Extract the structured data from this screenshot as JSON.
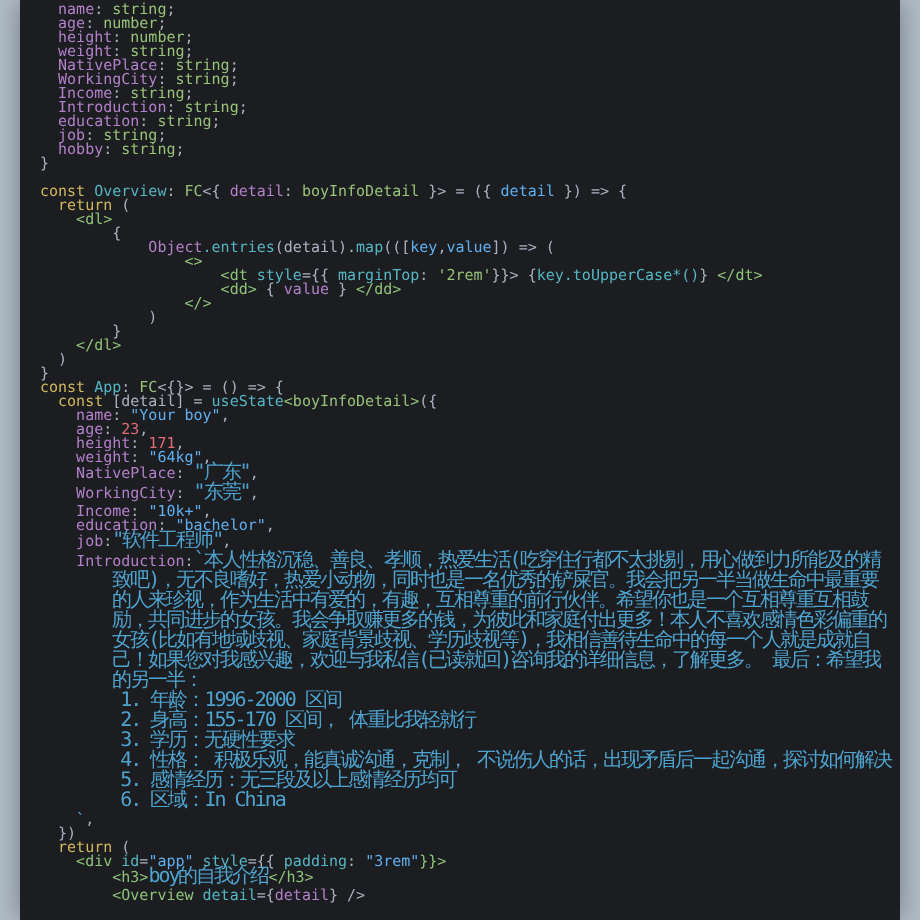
{
  "editor": {
    "lines": [
      {
        "kind": "code",
        "tokens": [
          {
            "t": "  name",
            "kind": "key"
          },
          {
            "t": ": ",
            "kind": "plain"
          },
          {
            "t": "string",
            "kind": "type"
          },
          {
            "t": ";",
            "kind": "plain"
          }
        ]
      },
      {
        "kind": "code",
        "tokens": [
          {
            "t": "  age",
            "kind": "key"
          },
          {
            "t": ": ",
            "kind": "plain"
          },
          {
            "t": "number",
            "kind": "type"
          },
          {
            "t": ";",
            "kind": "plain"
          }
        ]
      },
      {
        "kind": "code",
        "tokens": [
          {
            "t": "  height",
            "kind": "key"
          },
          {
            "t": ": ",
            "kind": "plain"
          },
          {
            "t": "number",
            "kind": "type"
          },
          {
            "t": ";",
            "kind": "plain"
          }
        ]
      },
      {
        "kind": "code",
        "tokens": [
          {
            "t": "  weight",
            "kind": "key"
          },
          {
            "t": ": ",
            "kind": "plain"
          },
          {
            "t": "string",
            "kind": "type"
          },
          {
            "t": ";",
            "kind": "plain"
          }
        ]
      },
      {
        "kind": "code",
        "tokens": [
          {
            "t": "  NativePlace",
            "kind": "key"
          },
          {
            "t": ": ",
            "kind": "plain"
          },
          {
            "t": "string",
            "kind": "type"
          },
          {
            "t": ";",
            "kind": "plain"
          }
        ]
      },
      {
        "kind": "code",
        "tokens": [
          {
            "t": "  WorkingCity",
            "kind": "key"
          },
          {
            "t": ": ",
            "kind": "plain"
          },
          {
            "t": "string",
            "kind": "type"
          },
          {
            "t": ";",
            "kind": "plain"
          }
        ]
      },
      {
        "kind": "code",
        "tokens": [
          {
            "t": "  Income",
            "kind": "key"
          },
          {
            "t": ": ",
            "kind": "plain"
          },
          {
            "t": "string",
            "kind": "type"
          },
          {
            "t": ";",
            "kind": "plain"
          }
        ]
      },
      {
        "kind": "code",
        "tokens": [
          {
            "t": "  Introduction",
            "kind": "key"
          },
          {
            "t": ": ",
            "kind": "plain"
          },
          {
            "t": "string",
            "kind": "type"
          },
          {
            "t": ";",
            "kind": "plain"
          }
        ]
      },
      {
        "kind": "code",
        "tokens": [
          {
            "t": "  education",
            "kind": "key"
          },
          {
            "t": ": ",
            "kind": "plain"
          },
          {
            "t": "string",
            "kind": "type"
          },
          {
            "t": ";",
            "kind": "plain"
          }
        ]
      },
      {
        "kind": "code",
        "tokens": [
          {
            "t": "  job",
            "kind": "key"
          },
          {
            "t": ": ",
            "kind": "plain"
          },
          {
            "t": "string",
            "kind": "type"
          },
          {
            "t": ";",
            "kind": "plain"
          }
        ]
      },
      {
        "kind": "code",
        "tokens": [
          {
            "t": "  hobby",
            "kind": "key"
          },
          {
            "t": ": ",
            "kind": "plain"
          },
          {
            "t": "string",
            "kind": "type"
          },
          {
            "t": ";",
            "kind": "plain"
          }
        ]
      },
      {
        "kind": "code",
        "tokens": [
          {
            "t": "}",
            "kind": "plain"
          }
        ]
      },
      {
        "kind": "blank"
      },
      {
        "kind": "code",
        "tokens": [
          {
            "t": "const ",
            "kind": "keyword"
          },
          {
            "t": "Overview",
            "kind": "fn"
          },
          {
            "t": ": ",
            "kind": "plain"
          },
          {
            "t": "FC",
            "kind": "type"
          },
          {
            "t": "<{ ",
            "kind": "plain"
          },
          {
            "t": "detail",
            "kind": "key"
          },
          {
            "t": ": ",
            "kind": "plain"
          },
          {
            "t": "boyInfoDetail",
            "kind": "type"
          },
          {
            "t": " }> = ({ ",
            "kind": "plain"
          },
          {
            "t": "detail",
            "kind": "var"
          },
          {
            "t": " }) => {",
            "kind": "plain"
          }
        ]
      },
      {
        "kind": "code",
        "tokens": [
          {
            "t": "  return",
            "kind": "keyword"
          },
          {
            "t": " (",
            "kind": "plain"
          }
        ]
      },
      {
        "kind": "code",
        "tokens": [
          {
            "t": "    <dl>",
            "kind": "tag"
          }
        ]
      },
      {
        "kind": "code",
        "tokens": [
          {
            "t": "        {",
            "kind": "plain"
          }
        ]
      },
      {
        "kind": "code",
        "tokens": [
          {
            "t": "            Object",
            "kind": "key"
          },
          {
            "t": ".entries",
            "kind": "fn"
          },
          {
            "t": "(detail).",
            "kind": "plain"
          },
          {
            "t": "map",
            "kind": "fn"
          },
          {
            "t": "(([",
            "kind": "plain"
          },
          {
            "t": "key",
            "kind": "var"
          },
          {
            "t": ",",
            "kind": "plain"
          },
          {
            "t": "value",
            "kind": "var"
          },
          {
            "t": "]) => (",
            "kind": "plain"
          }
        ]
      },
      {
        "kind": "code",
        "tokens": [
          {
            "t": "                <>",
            "kind": "tag"
          }
        ]
      },
      {
        "kind": "code",
        "tokens": [
          {
            "t": "                    <dt ",
            "kind": "tag"
          },
          {
            "t": "style",
            "kind": "fn"
          },
          {
            "t": "={{ ",
            "kind": "plain"
          },
          {
            "t": "marginTop",
            "kind": "fn"
          },
          {
            "t": ": ",
            "kind": "plain"
          },
          {
            "t": "'2rem'",
            "kind": "type"
          },
          {
            "t": "}}> {",
            "kind": "plain"
          },
          {
            "t": "key.toUpperCase*()",
            "kind": "fn"
          },
          {
            "t": "} ",
            "kind": "plain"
          },
          {
            "t": "</dt>",
            "kind": "tag"
          }
        ]
      },
      {
        "kind": "code",
        "tokens": [
          {
            "t": "                    <dd>",
            "kind": "tag"
          },
          {
            "t": " { ",
            "kind": "plain"
          },
          {
            "t": "value",
            "kind": "key"
          },
          {
            "t": " } ",
            "kind": "plain"
          },
          {
            "t": "</dd>",
            "kind": "tag"
          }
        ]
      },
      {
        "kind": "code",
        "tokens": [
          {
            "t": "                </>",
            "kind": "tag"
          }
        ]
      },
      {
        "kind": "code",
        "tokens": [
          {
            "t": "            )",
            "kind": "plain"
          }
        ]
      },
      {
        "kind": "code",
        "tokens": [
          {
            "t": "        }",
            "kind": "plain"
          }
        ]
      },
      {
        "kind": "code",
        "tokens": [
          {
            "t": "    </dl>",
            "kind": "tag"
          }
        ]
      },
      {
        "kind": "code",
        "tokens": [
          {
            "t": "  )",
            "kind": "plain"
          }
        ]
      },
      {
        "kind": "code",
        "tokens": [
          {
            "t": "}",
            "kind": "plain"
          }
        ]
      },
      {
        "kind": "code",
        "tokens": [
          {
            "t": "const ",
            "kind": "keyword"
          },
          {
            "t": "App",
            "kind": "fn"
          },
          {
            "t": ": ",
            "kind": "plain"
          },
          {
            "t": "FC",
            "kind": "type"
          },
          {
            "t": "<{}> = () => {",
            "kind": "plain"
          }
        ]
      },
      {
        "kind": "code",
        "tokens": [
          {
            "t": "  const ",
            "kind": "keyword"
          },
          {
            "t": "[detail] = ",
            "kind": "plain"
          },
          {
            "t": "useState",
            "kind": "fn"
          },
          {
            "t": "<boyInfoDetail>",
            "kind": "type"
          },
          {
            "t": "({",
            "kind": "plain"
          }
        ]
      },
      {
        "kind": "code",
        "tokens": [
          {
            "t": "    name",
            "kind": "key"
          },
          {
            "t": ": ",
            "kind": "plain"
          },
          {
            "t": "\"Your boy\"",
            "kind": "string"
          },
          {
            "t": ",",
            "kind": "plain"
          }
        ]
      },
      {
        "kind": "code",
        "tokens": [
          {
            "t": "    age",
            "kind": "key"
          },
          {
            "t": ": ",
            "kind": "plain"
          },
          {
            "t": "23",
            "kind": "number"
          },
          {
            "t": ",",
            "kind": "plain"
          }
        ]
      },
      {
        "kind": "code",
        "tokens": [
          {
            "t": "    height",
            "kind": "key"
          },
          {
            "t": ": ",
            "kind": "plain"
          },
          {
            "t": "171",
            "kind": "number"
          },
          {
            "t": ",",
            "kind": "plain"
          }
        ]
      },
      {
        "kind": "code",
        "tokens": [
          {
            "t": "    weight",
            "kind": "key"
          },
          {
            "t": ": ",
            "kind": "plain"
          },
          {
            "t": "\"64kg\"",
            "kind": "string"
          },
          {
            "t": ",",
            "kind": "plain"
          }
        ]
      },
      {
        "kind": "code",
        "tokens": [
          {
            "t": "    NativePlace",
            "kind": "key"
          },
          {
            "t": ": ",
            "kind": "plain"
          },
          {
            "t": "\"广东\"",
            "kind": "zh"
          },
          {
            "t": ",",
            "kind": "plain"
          }
        ]
      },
      {
        "kind": "code",
        "tokens": [
          {
            "t": "    WorkingCity",
            "kind": "key"
          },
          {
            "t": ": ",
            "kind": "plain"
          },
          {
            "t": "\"东莞\"",
            "kind": "zh"
          },
          {
            "t": ",",
            "kind": "plain"
          }
        ]
      },
      {
        "kind": "code",
        "tokens": [
          {
            "t": "    Income",
            "kind": "key"
          },
          {
            "t": ": ",
            "kind": "plain"
          },
          {
            "t": "\"10k+\"",
            "kind": "string"
          },
          {
            "t": ",",
            "kind": "plain"
          }
        ]
      },
      {
        "kind": "code",
        "tokens": [
          {
            "t": "    education",
            "kind": "key"
          },
          {
            "t": ": ",
            "kind": "plain"
          },
          {
            "t": "\"bachelor\"",
            "kind": "string"
          },
          {
            "t": ",",
            "kind": "plain"
          }
        ]
      },
      {
        "kind": "code",
        "tokens": [
          {
            "t": "    job",
            "kind": "key"
          },
          {
            "t": ":",
            "kind": "plain"
          },
          {
            "t": "\"软件工程师\"",
            "kind": "zh"
          },
          {
            "t": ",",
            "kind": "plain"
          }
        ]
      },
      {
        "kind": "wrapped",
        "tokens": [
          {
            "t": "    Introduction",
            "kind": "key"
          },
          {
            "t": ":",
            "kind": "plain"
          },
          {
            "t": "`本人性格沉稳、善良、孝顺，热爱生活(吃穿住行都不太挑剔，用心做到力所能及的精致吧)，无不良嗜好，热爱小动物，同时也是一名优秀的铲屎官。我会把另一半当做生命中最重要的人来珍视，作为生活中有爱的，有趣，互相尊重的前行伙伴。希望你也是一个互相尊重互相鼓励，共同进步的女孩。我会争取赚更多的钱，为彼此和家庭付出更多！本人不喜欢感情色彩偏重的女孩(比如有地域歧视、家庭背景歧视、学历歧视等)，我相信善待生命中的每一个人就是成就自己！如果您对我感兴趣，欢迎与我私信(已读就回)咨询我的详细信息，了解更多。 最后：希望我的另一半：",
            "kind": "zh"
          }
        ]
      },
      {
        "kind": "code",
        "tokens": [
          {
            "t": "        1. 年龄：1996-2000 区间",
            "kind": "zh"
          }
        ]
      },
      {
        "kind": "code",
        "tokens": [
          {
            "t": "        2. 身高：155-170 区间， 体重比我轻就行",
            "kind": "zh"
          }
        ]
      },
      {
        "kind": "code",
        "tokens": [
          {
            "t": "        3. 学历：无硬性要求",
            "kind": "zh"
          }
        ]
      },
      {
        "kind": "code",
        "tokens": [
          {
            "t": "        4. 性格： 积极乐观，能真诚沟通，克制， 不说伤人的话，出现矛盾后一起沟通，探讨如何解决",
            "kind": "zh"
          }
        ]
      },
      {
        "kind": "code",
        "tokens": [
          {
            "t": "        5. 感情经历：无三段及以上感情经历均可",
            "kind": "zh"
          }
        ]
      },
      {
        "kind": "code",
        "tokens": [
          {
            "t": "        6. 区域：In China",
            "kind": "zh"
          }
        ]
      },
      {
        "kind": "code",
        "tokens": [
          {
            "t": "    `",
            "kind": "string"
          },
          {
            "t": ",",
            "kind": "plain"
          }
        ]
      },
      {
        "kind": "code",
        "tokens": [
          {
            "t": "  })",
            "kind": "plain"
          }
        ]
      },
      {
        "kind": "code",
        "tokens": [
          {
            "t": "  return",
            "kind": "keyword"
          },
          {
            "t": " (",
            "kind": "plain"
          }
        ]
      },
      {
        "kind": "code",
        "tokens": [
          {
            "t": "    <div ",
            "kind": "tag"
          },
          {
            "t": "id",
            "kind": "fn"
          },
          {
            "t": "=",
            "kind": "plain"
          },
          {
            "t": "\"app\"",
            "kind": "string"
          },
          {
            "t": " style",
            "kind": "fn"
          },
          {
            "t": "={{ ",
            "kind": "plain"
          },
          {
            "t": "padding",
            "kind": "fn"
          },
          {
            "t": ": ",
            "kind": "plain"
          },
          {
            "t": "\"3rem\"",
            "kind": "string"
          },
          {
            "t": "}}>",
            "kind": "tag"
          }
        ]
      },
      {
        "kind": "code",
        "tokens": [
          {
            "t": "        <h3>",
            "kind": "tag"
          },
          {
            "t": "boy的自我介绍",
            "kind": "zh"
          },
          {
            "t": "</h3>",
            "kind": "tag"
          }
        ]
      },
      {
        "kind": "code",
        "tokens": [
          {
            "t": "        <Overview ",
            "kind": "tag"
          },
          {
            "t": "detail",
            "kind": "fn"
          },
          {
            "t": "={",
            "kind": "plain"
          },
          {
            "t": "detail",
            "kind": "key"
          },
          {
            "t": "} />",
            "kind": "plain"
          }
        ]
      }
    ]
  }
}
